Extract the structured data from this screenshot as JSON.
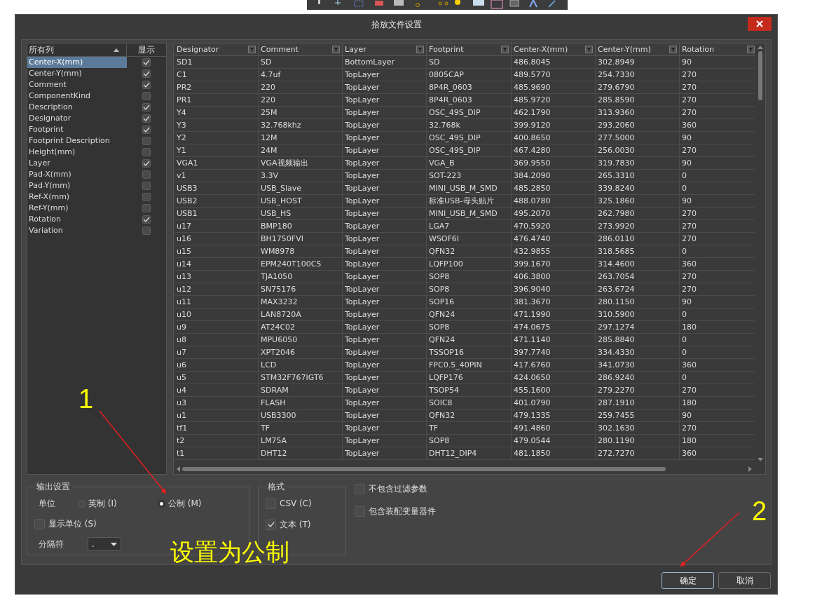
{
  "window": {
    "title": "拾放文件设置"
  },
  "columns_list": {
    "header": "所有列",
    "show_header": "显示",
    "items": [
      {
        "name": "Center-X(mm)",
        "selected": true,
        "shown": true
      },
      {
        "name": "Center-Y(mm)",
        "selected": false,
        "shown": true
      },
      {
        "name": "Comment",
        "selected": false,
        "shown": true
      },
      {
        "name": "ComponentKind",
        "selected": false,
        "shown": false
      },
      {
        "name": "Description",
        "selected": false,
        "shown": true
      },
      {
        "name": "Designator",
        "selected": false,
        "shown": true
      },
      {
        "name": "Footprint",
        "selected": false,
        "shown": true
      },
      {
        "name": "Footprint Description",
        "selected": false,
        "shown": false
      },
      {
        "name": "Height(mm)",
        "selected": false,
        "shown": false
      },
      {
        "name": "Layer",
        "selected": false,
        "shown": true
      },
      {
        "name": "Pad-X(mm)",
        "selected": false,
        "shown": false
      },
      {
        "name": "Pad-Y(mm)",
        "selected": false,
        "shown": false
      },
      {
        "name": "Ref-X(mm)",
        "selected": false,
        "shown": false
      },
      {
        "name": "Ref-Y(mm)",
        "selected": false,
        "shown": false
      },
      {
        "name": "Rotation",
        "selected": false,
        "shown": true
      },
      {
        "name": "Variation",
        "selected": false,
        "shown": false
      }
    ]
  },
  "table": {
    "columns": [
      "Designator",
      "Comment",
      "Layer",
      "Footprint",
      "Center-X(mm)",
      "Center-Y(mm)",
      "Rotation"
    ],
    "rows": [
      [
        "SD1",
        "SD",
        "BottomLayer",
        "SD",
        "486.8045",
        "302.8949",
        "90"
      ],
      [
        "C1",
        "4.7uf",
        "TopLayer",
        "0805CAP",
        "489.5770",
        "254.7330",
        "270"
      ],
      [
        "PR2",
        "220",
        "TopLayer",
        "8P4R_0603",
        "485.9690",
        "279.6790",
        "270"
      ],
      [
        "PR1",
        "220",
        "TopLayer",
        "8P4R_0603",
        "485.9720",
        "285.8590",
        "270"
      ],
      [
        "Y4",
        "25M",
        "TopLayer",
        "OSC_49S_DIP",
        "462.1790",
        "313.9360",
        "270"
      ],
      [
        "Y3",
        "32.768khz",
        "TopLayer",
        "32.768k",
        "399.9120",
        "293.2060",
        "360"
      ],
      [
        "Y2",
        "12M",
        "TopLayer",
        "OSC_49S_DIP",
        "400.8650",
        "277.5000",
        "90"
      ],
      [
        "Y1",
        "24M",
        "TopLayer",
        "OSC_49S_DIP",
        "467.4280",
        "256.0030",
        "270"
      ],
      [
        "VGA1",
        "VGA视频输出",
        "TopLayer",
        "VGA_B",
        "369.9550",
        "319.7830",
        "90"
      ],
      [
        "v1",
        "3.3V",
        "TopLayer",
        "SOT-223",
        "384.2090",
        "265.3310",
        "0"
      ],
      [
        "USB3",
        "USB_Slave",
        "TopLayer",
        "MINI_USB_M_SMD",
        "485.2850",
        "339.8240",
        "0"
      ],
      [
        "USB2",
        "USB_HOST",
        "TopLayer",
        "标准USB-母头贴片",
        "488.0780",
        "325.1860",
        "90"
      ],
      [
        "USB1",
        "USB_HS",
        "TopLayer",
        "MINI_USB_M_SMD",
        "495.2070",
        "262.7980",
        "270"
      ],
      [
        "u17",
        "BMP180",
        "TopLayer",
        "LGA7",
        "470.5920",
        "273.9920",
        "270"
      ],
      [
        "u16",
        "BH1750FVI",
        "TopLayer",
        "WSOF6I",
        "476.4740",
        "286.0110",
        "270"
      ],
      [
        "u15",
        "WM8978",
        "TopLayer",
        "QFN32",
        "432.9855",
        "318.5685",
        "0"
      ],
      [
        "u14",
        "EPM240T100C5",
        "TopLayer",
        "LQFP100",
        "399.1670",
        "314.4600",
        "360"
      ],
      [
        "u13",
        "TJA1050",
        "TopLayer",
        "SOP8",
        "406.3800",
        "263.7054",
        "270"
      ],
      [
        "u12",
        "SN75176",
        "TopLayer",
        "SOP8",
        "396.9040",
        "263.6724",
        "270"
      ],
      [
        "u11",
        "MAX3232",
        "TopLayer",
        "SOP16",
        "381.3670",
        "280.1150",
        "90"
      ],
      [
        "u10",
        "LAN8720A",
        "TopLayer",
        "QFN24",
        "471.1990",
        "310.5900",
        "0"
      ],
      [
        "u9",
        "AT24C02",
        "TopLayer",
        "SOP8",
        "474.0675",
        "297.1274",
        "180"
      ],
      [
        "u8",
        "MPU6050",
        "TopLayer",
        "QFN24",
        "471.1140",
        "285.8840",
        "0"
      ],
      [
        "u7",
        "XPT2046",
        "TopLayer",
        "TSSOP16",
        "397.7740",
        "334.4330",
        "0"
      ],
      [
        "u6",
        "LCD",
        "TopLayer",
        "FPC0.5_40PIN",
        "417.6760",
        "341.0730",
        "360"
      ],
      [
        "u5",
        "STM32F767IGT6",
        "TopLayer",
        "LQFP176",
        "424.0650",
        "286.9240",
        "0"
      ],
      [
        "u4",
        "SDRAM",
        "TopLayer",
        "TSOP54",
        "455.1600",
        "279.2270",
        "270"
      ],
      [
        "u3",
        "FLASH",
        "TopLayer",
        "SOIC8",
        "401.0790",
        "287.1910",
        "180"
      ],
      [
        "u1",
        "USB3300",
        "TopLayer",
        "QFN32",
        "479.1335",
        "259.7455",
        "90"
      ],
      [
        "tf1",
        "TF",
        "TopLayer",
        "TF",
        "491.4860",
        "302.1630",
        "270"
      ],
      [
        "t2",
        "LM75A",
        "TopLayer",
        "SOP8",
        "479.0544",
        "280.1190",
        "180"
      ],
      [
        "t1",
        "DHT12",
        "TopLayer",
        "DHT12_DIP4",
        "481.1850",
        "272.7270",
        "360"
      ]
    ]
  },
  "output_settings": {
    "title": "输出设置",
    "unit_label": "单位",
    "units": [
      {
        "label": "英制 (I)",
        "selected": false
      },
      {
        "label": "公制 (M)",
        "selected": true
      }
    ],
    "show_units": {
      "label": "显示单位 (S)",
      "checked": false
    },
    "separator_label": "分隔符",
    "separator_value": "."
  },
  "format": {
    "title": "格式",
    "options": [
      {
        "label": "CSV (C)",
        "checked": false
      },
      {
        "label": "文本 (T)",
        "checked": true
      }
    ]
  },
  "extra_options": [
    {
      "label": "不包含过滤参数",
      "checked": false
    },
    {
      "label": "包含装配变量器件",
      "checked": false
    }
  ],
  "buttons": [
    {
      "label": "确定",
      "focused": true
    },
    {
      "label": "取消",
      "focused": false
    }
  ],
  "annotations": [
    {
      "kind": "step",
      "text": "1"
    },
    {
      "kind": "step",
      "text": "2"
    },
    {
      "kind": "caption",
      "text": "设置为公制"
    }
  ]
}
